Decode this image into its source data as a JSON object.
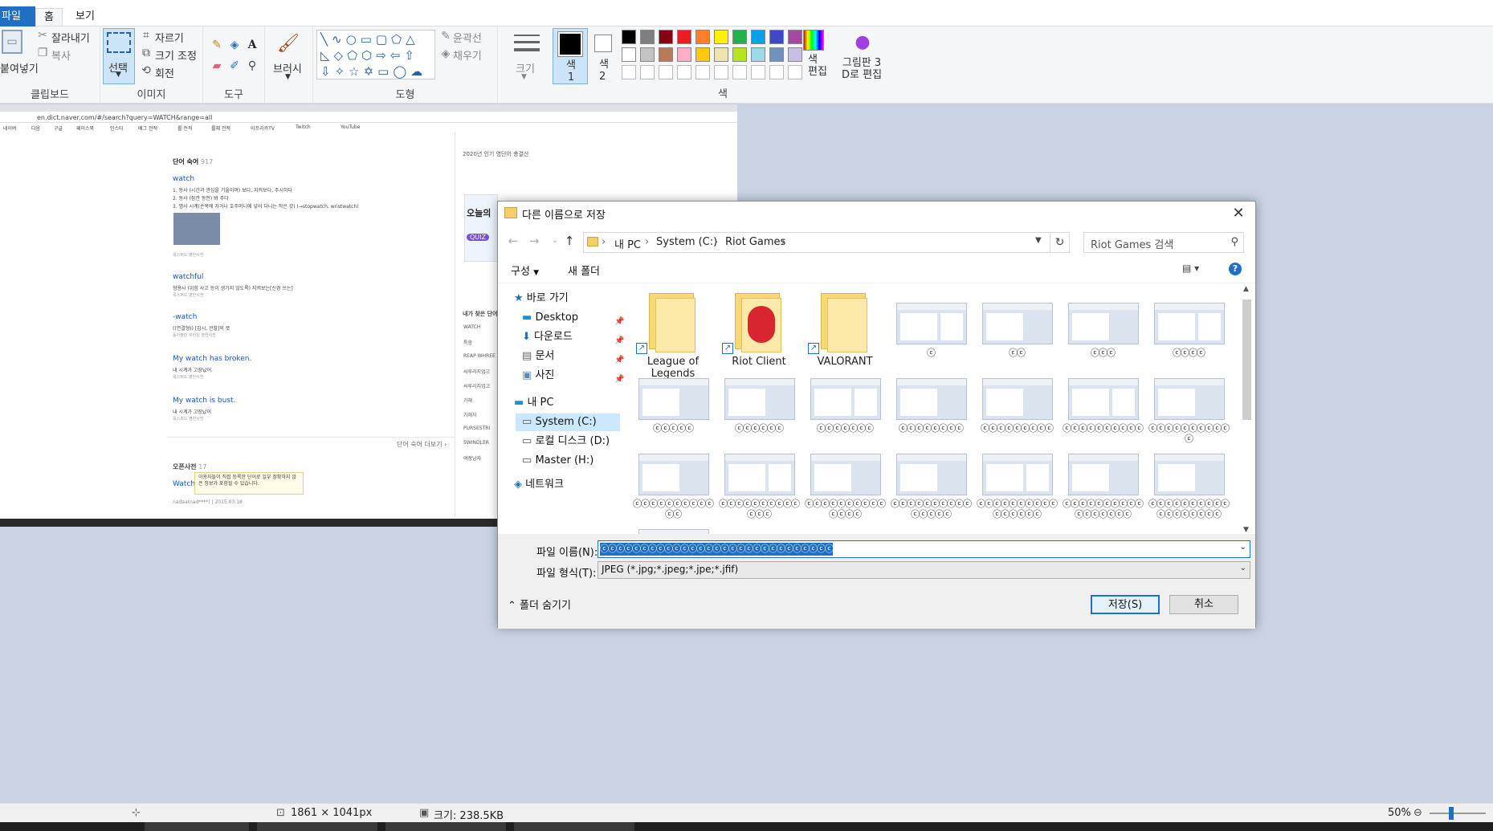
{
  "ribbon": {
    "tabs": {
      "file": "파일",
      "home": "홈",
      "view": "보기"
    },
    "clipboard": {
      "paste": "붙여넣기",
      "cut": "잘라내기",
      "copy": "복사",
      "label": "클립보드"
    },
    "image": {
      "select": "선택",
      "crop": "자르기",
      "resize": "크기 조정",
      "rotate": "회전",
      "label": "이미지"
    },
    "tools": {
      "label": "도구"
    },
    "brushes": {
      "label": "브러시"
    },
    "shapes": {
      "outline": "윤곽선",
      "fill": "채우기",
      "label": "도형"
    },
    "size": {
      "label": "크기"
    },
    "color1": {
      "label": "색\n1"
    },
    "color2": {
      "label": "색\n2"
    },
    "edit_colors": {
      "label": "색\n편집"
    },
    "paint3d": {
      "label": "그림판 3\nD로 편집"
    },
    "colors": {
      "label": "색"
    }
  },
  "colors": {
    "accent": "#1f6fc5",
    "palette_row1": [
      "#000000",
      "#7f7f7f",
      "#880015",
      "#ed1c24",
      "#ff7f27",
      "#fff200",
      "#22b14c",
      "#00a2e8",
      "#3f48cc",
      "#a349a4"
    ],
    "palette_row2": [
      "#ffffff",
      "#c3c3c3",
      "#b97a57",
      "#ffaec9",
      "#ffc90e",
      "#efe4b0",
      "#b5e61d",
      "#99d9ea",
      "#7092be",
      "#c8bfe7"
    ]
  },
  "canvas_content": {
    "url": "en.dict.naver.com/#/search?query=WATCH&range=all",
    "bookmarks": [
      "네이버",
      "다음",
      "구글",
      "페이스북",
      "인스타",
      "배그 전적",
      "롤 전적",
      "롤체 전적",
      "아프리카TV",
      "Twitch",
      "YouTube"
    ],
    "section_title": "단어 숙어",
    "section_count": "917",
    "entries": [
      {
        "word": "watch",
        "lines": [
          "1. 동사 (시간과 관심을 기울이며) 보다, 지켜보다, 주시하다",
          "2. 동사 (잠깐 동안) 봐 주다",
          "3. 명사 시계(손목에 차거나 호주머니에 넣어 다니는 작은 것) (→stopwatch, wristwatch)"
        ],
        "source": "옥스퍼드 영한사전"
      },
      {
        "word": "watchful",
        "lines": [
          "형용사 (위험 사고 등이 생기지 않도록) 지켜보는[신경 쓰는]"
        ],
        "source": "옥스퍼드 영한사전"
      },
      {
        "word": "-watch",
        "lines": [
          "((연결형)) [감시, 관찰]의 뜻"
        ],
        "source": "동아출판 프라임 영한사전"
      },
      {
        "word": "My watch has broken.",
        "lines": [
          "내 시계가 고장났어."
        ],
        "source": "옥스퍼드 영한사전"
      },
      {
        "word": "My watch is bust.",
        "lines": [
          "내 시계가 고장났어"
        ],
        "source": "옥스퍼드 영한사전"
      }
    ],
    "more_link": "단어 숙어 더보기 ›",
    "open_dict": "오픈사전",
    "open_count": "17",
    "tooltip": "이용자들이 직접 등록한 단어로 일부 정확하지 않은 정보가 포함될 수 있습니다.",
    "open_word": "Watch",
    "open_user": "nadaa(nad****)",
    "open_date": "2015.03.18",
    "side_top": "2020년 인기 영단어 총결산",
    "side_heading": "오늘의",
    "side_tag": "QUIZ",
    "side_list_title": "내가 찾은 단어",
    "side_list": [
      "WATCH",
      "특함",
      "REAP WHREE",
      "씨루리지업고",
      "씨루리지업고",
      "가해",
      "가해자",
      "PURSESTRI",
      "SWINDLER",
      "여장남자"
    ]
  },
  "dialog": {
    "title": "다른 이름으로 저장",
    "breadcrumb": [
      "내 PC",
      "System (C:)",
      "Riot Games"
    ],
    "search_placeholder": "Riot Games 검색",
    "organize": "구성",
    "new_folder": "새 폴더",
    "tree": {
      "quick_access": "바로 가기",
      "desktop": "Desktop",
      "downloads": "다운로드",
      "documents": "문서",
      "pictures": "사진",
      "this_pc": "내 PC",
      "system_c": "System (C:)",
      "local_d": "로컬 디스크 (D:)",
      "master_h": "Master (H:)",
      "network": "네트워크"
    },
    "files": [
      {
        "name": "League of Legends",
        "kind": "folder"
      },
      {
        "name": "Riot Client",
        "kind": "folder"
      },
      {
        "name": "VALORANT",
        "kind": "folder"
      },
      {
        "name": "ⓒ",
        "kind": "image"
      },
      {
        "name": "ⓒⓒ",
        "kind": "image"
      },
      {
        "name": "ⓒⓒⓒ",
        "kind": "image"
      },
      {
        "name": "ⓒⓒⓒⓒ",
        "kind": "image"
      },
      {
        "name": "ⓒⓒⓒⓒⓒ",
        "kind": "image"
      },
      {
        "name": "ⓒⓒⓒⓒⓒⓒ",
        "kind": "image"
      },
      {
        "name": "ⓒⓒⓒⓒⓒⓒⓒ",
        "kind": "image"
      },
      {
        "name": "ⓒⓒⓒⓒⓒⓒⓒⓒ",
        "kind": "image"
      },
      {
        "name": "ⓒⓒⓒⓒⓒⓒⓒⓒⓒ",
        "kind": "image"
      },
      {
        "name": "ⓒⓒⓒⓒⓒⓒⓒⓒⓒⓒ",
        "kind": "image"
      },
      {
        "name": "ⓒⓒⓒⓒⓒⓒⓒⓒⓒⓒⓒ",
        "kind": "image"
      },
      {
        "name": "ⓒⓒⓒⓒⓒⓒⓒⓒⓒⓒⓒⓒ",
        "kind": "image"
      },
      {
        "name": "ⓒⓒⓒⓒⓒⓒⓒⓒⓒⓒⓒⓒⓒ",
        "kind": "image"
      },
      {
        "name": "ⓒⓒⓒⓒⓒⓒⓒⓒⓒⓒⓒⓒⓒⓒ",
        "kind": "image"
      },
      {
        "name": "ⓒⓒⓒⓒⓒⓒⓒⓒⓒⓒⓒⓒⓒⓒⓒ",
        "kind": "image"
      },
      {
        "name": "ⓒⓒⓒⓒⓒⓒⓒⓒⓒⓒⓒⓒⓒⓒⓒⓒ",
        "kind": "image"
      },
      {
        "name": "ⓒⓒⓒⓒⓒⓒⓒⓒⓒⓒⓒⓒⓒⓒⓒⓒⓒ",
        "kind": "image"
      },
      {
        "name": "ⓒⓒⓒⓒⓒⓒⓒⓒⓒⓒⓒⓒⓒⓒⓒⓒⓒⓒ",
        "kind": "image"
      },
      {
        "name": "ⓒⓒⓒⓒⓒⓒⓒⓒⓒⓒⓒⓒⓒⓒⓒⓒⓒⓒⓒ",
        "kind": "image"
      }
    ],
    "filename_label": "파일 이름(N):",
    "filename_value": "ⓒⓒⓒⓒⓒⓒⓒⓒⓒⓒⓒⓒⓒⓒⓒⓒⓒⓒⓒⓒⓒⓒⓒⓒⓒⓒⓒⓒⓒ",
    "filetype_label": "파일 형식(T):",
    "filetype_value": "JPEG (*.jpg;*.jpeg;*.jpe;*.jfif)",
    "hide_folders": "폴더 숨기기",
    "save": "저장(S)",
    "cancel": "취소"
  },
  "statusbar": {
    "dimensions": "1861 × 1041px",
    "size": "크기: 238.5KB",
    "zoom": "50%"
  }
}
